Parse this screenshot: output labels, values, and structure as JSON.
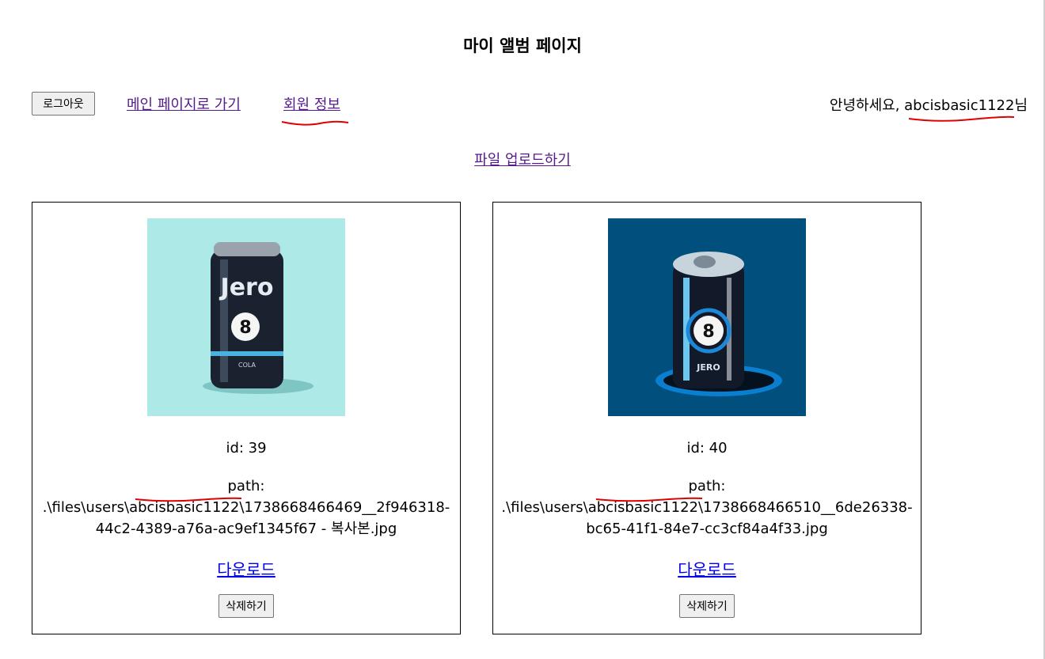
{
  "page": {
    "title": "마이 앨범 페이지"
  },
  "nav": {
    "logout_label": "로그아웃",
    "main_page_link": "메인 페이지로 가기",
    "member_info_link": "회원 정보",
    "greeting_prefix": "안녕하세요, ",
    "username": "abcisbasic1122",
    "greeting_suffix": "님"
  },
  "upload_link": "파일 업로드하기",
  "photos": [
    {
      "id_text": "id: 39",
      "path_label": "path:",
      "path_value": ".\\files\\users\\abcisbasic1122\\1738668466469__2f946318-44c2-4389-a76a-ac9ef1345f67 - 복사본.jpg",
      "download_label": "다운로드",
      "delete_label": "삭제하기",
      "image": {
        "bg_color": "#ade9e6",
        "can_label": "Jero",
        "ball_number": "8",
        "small_label": "COLA"
      }
    },
    {
      "id_text": "id: 40",
      "path_label": "path:",
      "path_value": ".\\files\\users\\abcisbasic1122\\1738668466510__6de26338-bc65-41f1-84e7-cc3cf84a4f33.jpg",
      "download_label": "다운로드",
      "delete_label": "삭제하기",
      "image": {
        "bg_color": "#004f7d",
        "can_label": "JERO",
        "ball_number": "8"
      }
    }
  ],
  "colors": {
    "visited_link": "#551a8b",
    "link": "#0000ee",
    "annotation_red": "#e00000"
  }
}
